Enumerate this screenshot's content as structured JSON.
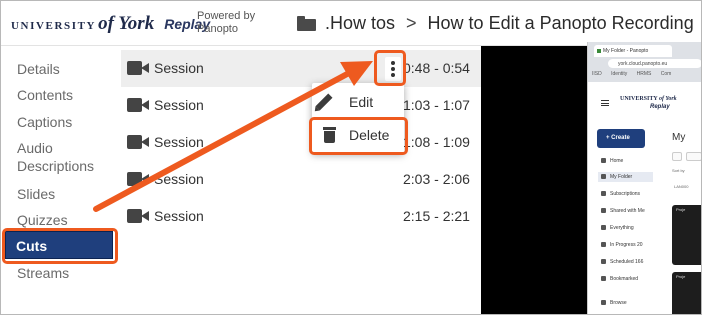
{
  "header": {
    "logo_prefix": "UNIVERSITY",
    "logo_of_york": "of York",
    "logo_replay": "Replay",
    "powered_by": "Powered by Panopto",
    "breadcrumb_folder": ".How tos",
    "breadcrumb_separator": ">",
    "breadcrumb_page": "How to Edit a Panopto Recording"
  },
  "sidebar": {
    "items": [
      {
        "label": "Details"
      },
      {
        "label": "Contents"
      },
      {
        "label": "Captions"
      },
      {
        "label": "Audio Descriptions"
      },
      {
        "label": "Slides"
      },
      {
        "label": "Quizzes"
      },
      {
        "label": "Cuts"
      },
      {
        "label": "Streams"
      }
    ],
    "active": "Cuts"
  },
  "sessions": [
    {
      "label": "Session",
      "time": "0:48 - 0:54"
    },
    {
      "label": "Session",
      "time": "1:03 - 1:07"
    },
    {
      "label": "Session",
      "time": "1:08 - 1:09"
    },
    {
      "label": "Session",
      "time": "2:03 - 2:06"
    },
    {
      "label": "Session",
      "time": "2:15 - 2:21"
    }
  ],
  "context_menu": {
    "edit_label": "Edit",
    "delete_label": "Delete"
  },
  "icons": {
    "folder": "folder-icon",
    "session": "video-camera-icon",
    "more": "more-vertical-icon",
    "edit": "pencil-icon",
    "delete": "trash-icon"
  },
  "colors": {
    "accent": "#1f3f7d",
    "highlight": "#ee5a1f"
  },
  "preview_browser": {
    "tab_title": "My Folder - Panopto",
    "url": "york.cloud.panopto.eu",
    "bookmarks": [
      "IISD",
      "Identity",
      "HRMS",
      "Com"
    ],
    "logo_prefix": "UNIVERSITY",
    "logo_of_york": "of York",
    "logo_replay": "Replay",
    "create_label": "Create",
    "heading": "My",
    "sort_label": "Sort by",
    "folder_code": "LAN000",
    "thumb_label": "Proje",
    "nav": [
      {
        "label": "Home"
      },
      {
        "label": "My Folder"
      },
      {
        "label": "Subscriptions"
      },
      {
        "label": "Shared with Me"
      },
      {
        "label": "Everything"
      },
      {
        "label": "In Progress",
        "count": "20"
      },
      {
        "label": "Scheduled",
        "count": "166"
      },
      {
        "label": "Bookmarked"
      },
      {
        "label": "Browse"
      }
    ]
  }
}
